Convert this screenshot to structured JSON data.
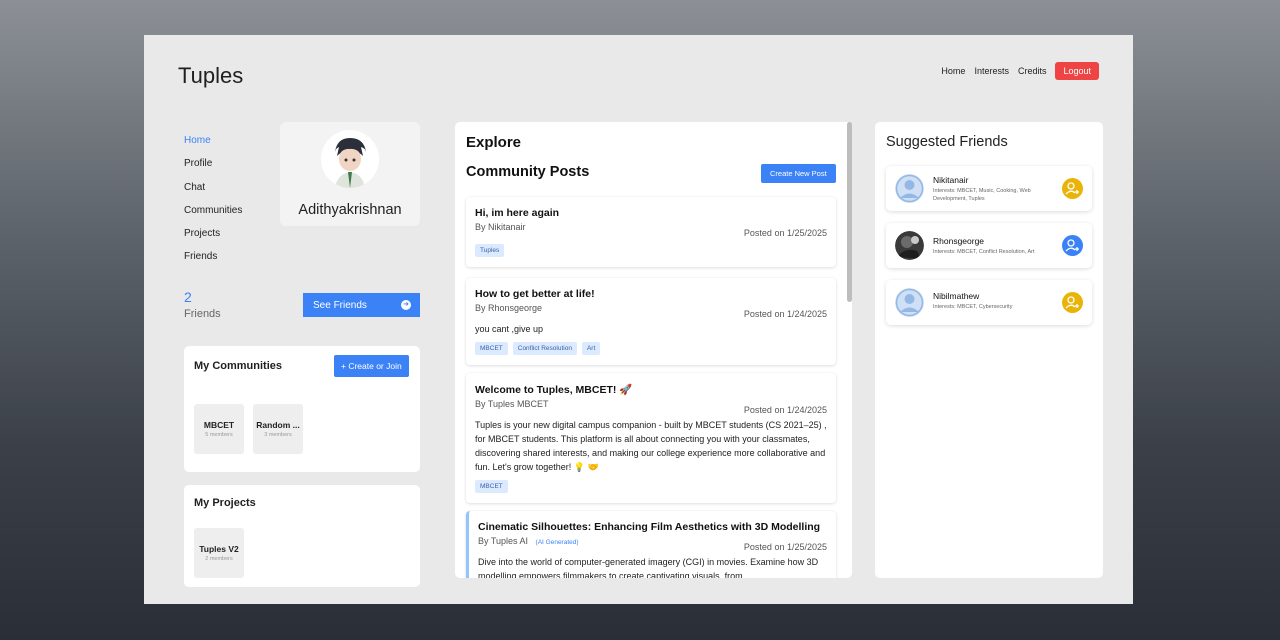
{
  "app": {
    "brand": "Tuples"
  },
  "topnav": {
    "home": "Home",
    "interests": "Interests",
    "credits": "Credits",
    "logout": "Logout"
  },
  "sidenav": {
    "items": [
      "Home",
      "Profile",
      "Chat",
      "Communities",
      "Projects",
      "Friends"
    ],
    "active": "Home"
  },
  "profile": {
    "name": "Adithyakrishnan",
    "avatar_icon": "user-avatar-icon"
  },
  "friends": {
    "count": "2",
    "label": "Friends",
    "see_button": "See Friends"
  },
  "communities": {
    "title": "My Communities",
    "button": "+ Create or Join",
    "items": [
      {
        "name": "MBCET",
        "members": "5 members"
      },
      {
        "name": "Random ...",
        "members": "3 members"
      }
    ]
  },
  "projects": {
    "title": "My Projects",
    "items": [
      {
        "name": "Tuples V2",
        "members": "2 members"
      }
    ]
  },
  "feed": {
    "explore": "Explore",
    "community_posts": "Community Posts",
    "create_button": "Create New Post",
    "posts": [
      {
        "title": "Hi, im here again",
        "author": "By Nikitanair",
        "date": "Posted on 1/25/2025",
        "body": "",
        "tags": [
          "Tuples"
        ]
      },
      {
        "title": "How to get better at life!",
        "author": "By Rhonsgeorge",
        "date": "Posted on 1/24/2025",
        "body": "you cant ,give up",
        "tags": [
          "MBCET",
          "Conflict Resolution",
          "Art"
        ]
      },
      {
        "title": "Welcome to Tuples, MBCET! 🚀",
        "author": "By Tuples MBCET",
        "date": "Posted on 1/24/2025",
        "body": "Tuples is your new digital campus companion - built by MBCET students (CS 2021–25) , for MBCET students. This platform is all about connecting you with your classmates, discovering shared interests, and making our college experience more collaborative and fun. Let's grow together! 💡 🤝",
        "tags": [
          "MBCET"
        ]
      },
      {
        "title": "Cinematic Silhouettes: Enhancing Film Aesthetics with 3D Modelling",
        "author": "By Tuples AI",
        "ai_badge": "(AI Generated)",
        "date": "Posted on 1/25/2025",
        "body": "Dive into the world of computer-generated imagery (CGI) in movies. Examine how 3D modelling empowers filmmakers to create captivating visuals, from",
        "tags": []
      }
    ]
  },
  "suggested": {
    "title": "Suggested Friends",
    "people": [
      {
        "name": "Nikitanair",
        "interests": "Interests: MBCET, Music, Cooking, Web Development, Tuples",
        "color": "#eab308"
      },
      {
        "name": "Rhonsgeorge",
        "interests": "Interests: MBCET, Conflict Resolution, Art",
        "color": "#3b82f6"
      },
      {
        "name": "Nibilmathew",
        "interests": "Interests: MBCET, Cybersecurity",
        "color": "#eab308"
      }
    ]
  }
}
